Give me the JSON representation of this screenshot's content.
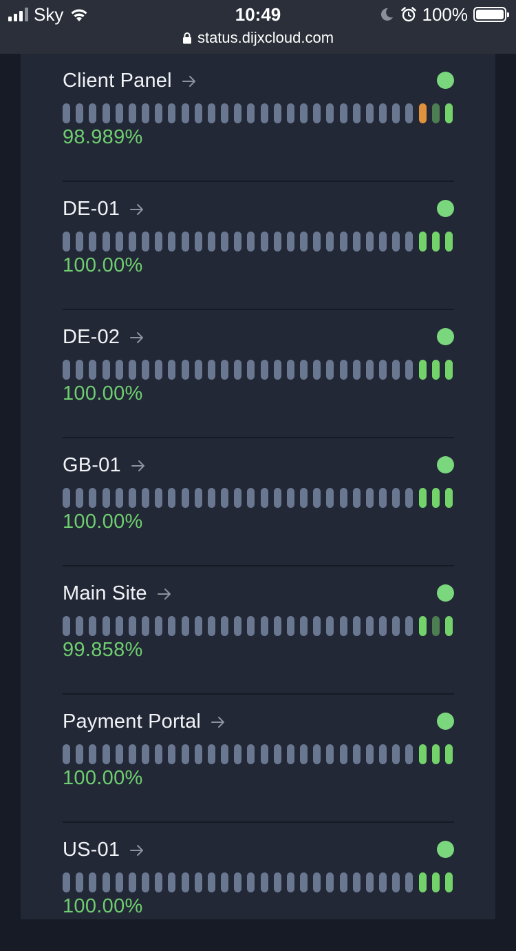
{
  "status_bar": {
    "carrier": "Sky",
    "time": "10:49",
    "battery": "100%",
    "url": "status.dijxcloud.com"
  },
  "colors": {
    "operational": "#7ad77d",
    "no_data": "#6a7791",
    "degraded": "#e0913b",
    "partial": "#4d7d52"
  },
  "monitors": [
    {
      "name": "Client Panel",
      "uptime": "98.989%",
      "bars": [
        "n",
        "n",
        "n",
        "n",
        "n",
        "n",
        "n",
        "n",
        "n",
        "n",
        "n",
        "n",
        "n",
        "n",
        "n",
        "n",
        "n",
        "n",
        "n",
        "n",
        "n",
        "n",
        "n",
        "n",
        "n",
        "n",
        "n",
        "o",
        "d",
        "g"
      ]
    },
    {
      "name": "DE-01",
      "uptime": "100.00%",
      "bars": [
        "n",
        "n",
        "n",
        "n",
        "n",
        "n",
        "n",
        "n",
        "n",
        "n",
        "n",
        "n",
        "n",
        "n",
        "n",
        "n",
        "n",
        "n",
        "n",
        "n",
        "n",
        "n",
        "n",
        "n",
        "n",
        "n",
        "n",
        "g",
        "g",
        "g"
      ]
    },
    {
      "name": "DE-02",
      "uptime": "100.00%",
      "bars": [
        "n",
        "n",
        "n",
        "n",
        "n",
        "n",
        "n",
        "n",
        "n",
        "n",
        "n",
        "n",
        "n",
        "n",
        "n",
        "n",
        "n",
        "n",
        "n",
        "n",
        "n",
        "n",
        "n",
        "n",
        "n",
        "n",
        "n",
        "g",
        "g",
        "g"
      ]
    },
    {
      "name": "GB-01",
      "uptime": "100.00%",
      "bars": [
        "n",
        "n",
        "n",
        "n",
        "n",
        "n",
        "n",
        "n",
        "n",
        "n",
        "n",
        "n",
        "n",
        "n",
        "n",
        "n",
        "n",
        "n",
        "n",
        "n",
        "n",
        "n",
        "n",
        "n",
        "n",
        "n",
        "n",
        "g",
        "g",
        "g"
      ]
    },
    {
      "name": "Main Site",
      "uptime": "99.858%",
      "bars": [
        "n",
        "n",
        "n",
        "n",
        "n",
        "n",
        "n",
        "n",
        "n",
        "n",
        "n",
        "n",
        "n",
        "n",
        "n",
        "n",
        "n",
        "n",
        "n",
        "n",
        "n",
        "n",
        "n",
        "n",
        "n",
        "n",
        "n",
        "g",
        "d",
        "g"
      ]
    },
    {
      "name": "Payment Portal",
      "uptime": "100.00%",
      "bars": [
        "n",
        "n",
        "n",
        "n",
        "n",
        "n",
        "n",
        "n",
        "n",
        "n",
        "n",
        "n",
        "n",
        "n",
        "n",
        "n",
        "n",
        "n",
        "n",
        "n",
        "n",
        "n",
        "n",
        "n",
        "n",
        "n",
        "n",
        "g",
        "g",
        "g"
      ]
    },
    {
      "name": "US-01",
      "uptime": "100.00%",
      "bars": [
        "n",
        "n",
        "n",
        "n",
        "n",
        "n",
        "n",
        "n",
        "n",
        "n",
        "n",
        "n",
        "n",
        "n",
        "n",
        "n",
        "n",
        "n",
        "n",
        "n",
        "n",
        "n",
        "n",
        "n",
        "n",
        "n",
        "n",
        "g",
        "g",
        "g"
      ]
    }
  ]
}
